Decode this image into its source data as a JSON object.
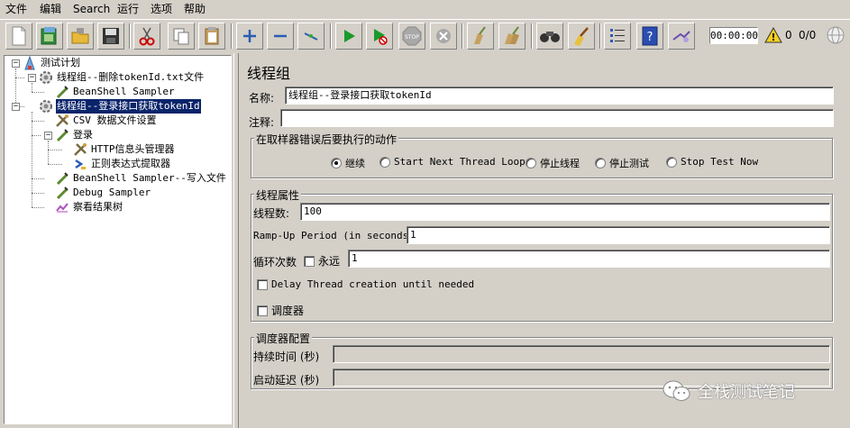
{
  "menu": [
    "文件",
    "编辑",
    "Search",
    "运行",
    "选项",
    "帮助"
  ],
  "toolbar": {
    "icons": [
      "new-icon",
      "templates-icon",
      "open-icon",
      "save-icon",
      "cut-icon",
      "copy-icon",
      "paste-icon",
      "expand-icon",
      "collapse-icon",
      "toggle-icon",
      "start-icon",
      "start-no-pause-icon",
      "stop-icon",
      "shutdown-icon",
      "clear-icon",
      "clear-all-icon",
      "search-icon",
      "reset-search-icon",
      "function-helper-icon",
      "help-icon",
      "remote-icon"
    ],
    "timer": "00:00:00",
    "error_count": "0",
    "thread_count": "0/0"
  },
  "tree": {
    "items": [
      {
        "label": "测试计划",
        "icon": "test-plan-icon"
      },
      {
        "label": "线程组--删除tokenId.txt文件",
        "icon": "thread-group-icon"
      },
      {
        "label": "BeanShell Sampler",
        "icon": "sampler-icon"
      },
      {
        "label": "线程组--登录接口获取tokenId",
        "icon": "thread-group-icon"
      },
      {
        "label": "CSV 数据文件设置",
        "icon": "config-icon"
      },
      {
        "label": "登录",
        "icon": "sampler-icon"
      },
      {
        "label": "HTTP信息头管理器",
        "icon": "config-icon"
      },
      {
        "label": "正则表达式提取器",
        "icon": "extractor-icon"
      },
      {
        "label": "BeanShell Sampler--写入文件",
        "icon": "sampler-icon"
      },
      {
        "label": "Debug Sampler",
        "icon": "sampler-icon"
      },
      {
        "label": "察看结果树",
        "icon": "listener-icon"
      }
    ]
  },
  "panel": {
    "title": "线程组",
    "name_label": "名称:",
    "name_value": "线程组--登录接口获取tokenId",
    "comment_label": "注释:",
    "comment_value": "",
    "error_action": {
      "title": "在取样器错误后要执行的动作",
      "options": [
        "继续",
        "Start Next Thread Loop",
        "停止线程",
        "停止测试",
        "Stop Test Now"
      ],
      "selected": "继续"
    },
    "thread_props": {
      "title": "线程属性",
      "threads_label": "线程数:",
      "threads_value": "100",
      "rampup_label": "Ramp-Up Period (in seconds):",
      "rampup_value": "1",
      "loop_label": "循环次数",
      "forever_label": "永远",
      "loop_value": "1",
      "delay_label": "Delay Thread creation until needed",
      "scheduler_label": "调度器"
    },
    "scheduler_config": {
      "title": "调度器配置",
      "duration_label": "持续时间 (秒)",
      "delay_label": "启动延迟 (秒)"
    }
  },
  "watermark": "全栈测试笔记"
}
